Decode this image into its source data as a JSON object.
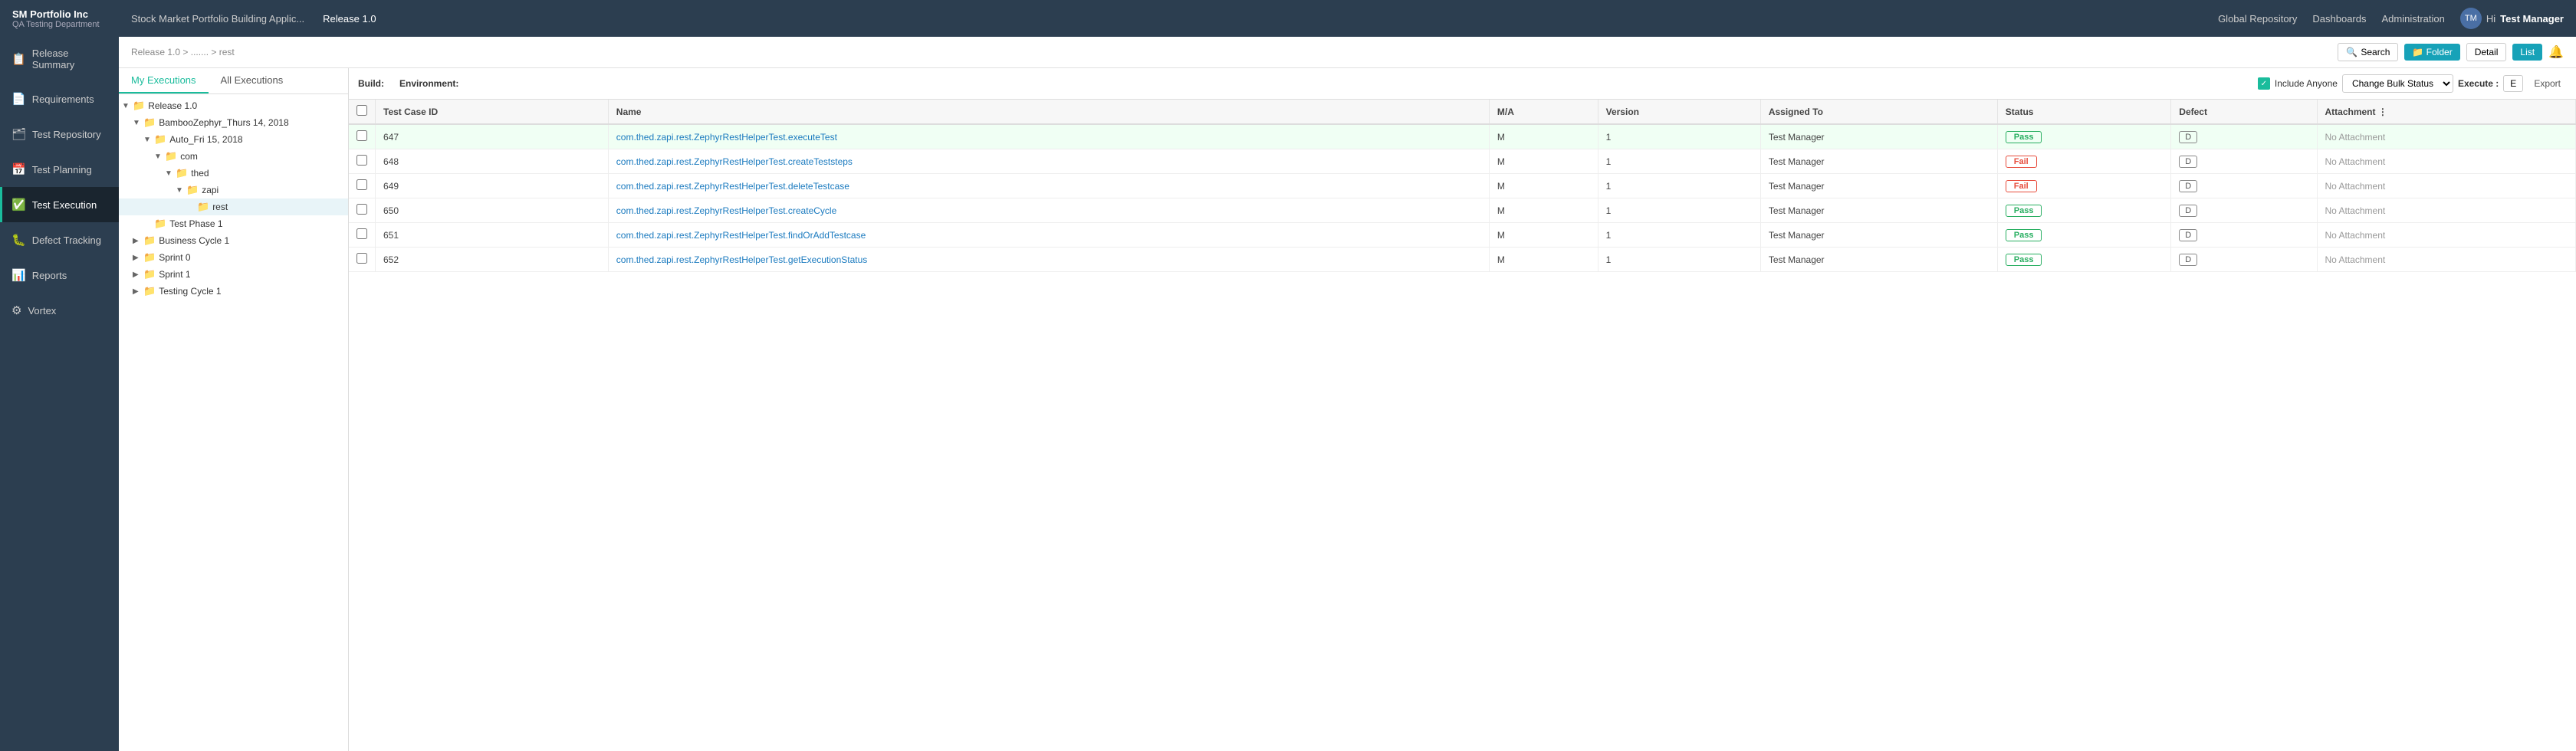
{
  "brand": {
    "name": "SM Portfolio Inc",
    "sub": "QA Testing Department"
  },
  "topnav": {
    "project": "Stock Market Portfolio Building Applic...",
    "release": "Release 1.0",
    "links": [
      "Global Repository",
      "Dashboards",
      "Administration"
    ],
    "user_hi": "Hi",
    "user_name": "Test Manager"
  },
  "sidebar": {
    "items": [
      {
        "label": "Release Summary",
        "icon": "📋",
        "active": false
      },
      {
        "label": "Requirements",
        "icon": "📄",
        "active": false
      },
      {
        "label": "Test Repository",
        "icon": "🗂",
        "active": false
      },
      {
        "label": "Test Planning",
        "icon": "📅",
        "active": false
      },
      {
        "label": "Test Execution",
        "icon": "✅",
        "active": true
      },
      {
        "label": "Defect Tracking",
        "icon": "🐛",
        "active": false
      },
      {
        "label": "Reports",
        "icon": "📊",
        "active": false
      },
      {
        "label": "Vortex",
        "icon": "⚙",
        "active": false
      }
    ]
  },
  "breadcrumb": {
    "parts": [
      "Release 1.0",
      ">",
      ".......",
      ">",
      "rest"
    ]
  },
  "toolbar_buttons": {
    "search": "🔍 Search",
    "folder": "📁 Folder",
    "detail": "Detail",
    "list": "List"
  },
  "tabs": {
    "my_executions": "My Executions",
    "all_executions": "All Executions"
  },
  "tree": {
    "items": [
      {
        "indent": 0,
        "toggle": "▼",
        "label": "Release 1.0",
        "icon": "folder"
      },
      {
        "indent": 1,
        "toggle": "▼",
        "label": "BambooZephyr_Thurs 14, 2018",
        "icon": "folder-dark"
      },
      {
        "indent": 2,
        "toggle": "▼",
        "label": "Auto_Fri 15, 2018",
        "icon": "folder-dark"
      },
      {
        "indent": 3,
        "toggle": "▼",
        "label": "com",
        "icon": "folder"
      },
      {
        "indent": 4,
        "toggle": "▼",
        "label": "thed",
        "icon": "folder"
      },
      {
        "indent": 5,
        "toggle": "▼",
        "label": "zapi",
        "icon": "folder"
      },
      {
        "indent": 6,
        "toggle": "",
        "label": "rest",
        "icon": "folder-light",
        "selected": true
      },
      {
        "indent": 2,
        "toggle": "",
        "label": "Test Phase 1",
        "icon": "folder-light"
      },
      {
        "indent": 1,
        "toggle": "▶",
        "label": "Business Cycle 1",
        "icon": "folder-light"
      },
      {
        "indent": 1,
        "toggle": "▶",
        "label": "Sprint 0",
        "icon": "folder-light"
      },
      {
        "indent": 1,
        "toggle": "▶",
        "label": "Sprint 1",
        "icon": "folder-light"
      },
      {
        "indent": 1,
        "toggle": "▶",
        "label": "Testing Cycle 1",
        "icon": "folder-light"
      }
    ]
  },
  "toolbar": {
    "build_label": "Build:",
    "environment_label": "Environment:",
    "include_anyone": "Include Anyone",
    "change_bulk_status": "Change Bulk Status",
    "execute_label": "Execute :",
    "execute_key": "E",
    "export_label": "Export"
  },
  "table": {
    "columns": [
      "",
      "Test Case ID",
      "Name",
      "M/A",
      "Version",
      "Assigned To",
      "Status",
      "Defect",
      "Attachment"
    ],
    "rows": [
      {
        "id": "647",
        "name": "com.thed.zapi.rest.ZephyrRestHelperTest.executeTest",
        "ma": "M",
        "version": "1",
        "assigned": "Test Manager",
        "status": "Pass",
        "defect": "D",
        "attachment": "No Attachment",
        "highlight": true
      },
      {
        "id": "648",
        "name": "com.thed.zapi.rest.ZephyrRestHelperTest.createTeststeps",
        "ma": "M",
        "version": "1",
        "assigned": "Test Manager",
        "status": "Fail",
        "defect": "D",
        "attachment": "No Attachment",
        "highlight": false
      },
      {
        "id": "649",
        "name": "com.thed.zapi.rest.ZephyrRestHelperTest.deleteTestcase",
        "ma": "M",
        "version": "1",
        "assigned": "Test Manager",
        "status": "Fail",
        "defect": "D",
        "attachment": "No Attachment",
        "highlight": false
      },
      {
        "id": "650",
        "name": "com.thed.zapi.rest.ZephyrRestHelperTest.createCycle",
        "ma": "M",
        "version": "1",
        "assigned": "Test Manager",
        "status": "Pass",
        "defect": "D",
        "attachment": "No Attachment",
        "highlight": false
      },
      {
        "id": "651",
        "name": "com.thed.zapi.rest.ZephyrRestHelperTest.findOrAddTestcase",
        "ma": "M",
        "version": "1",
        "assigned": "Test Manager",
        "status": "Pass",
        "defect": "D",
        "attachment": "No Attachment",
        "highlight": false
      },
      {
        "id": "652",
        "name": "com.thed.zapi.rest.ZephyrRestHelperTest.getExecutionStatus",
        "ma": "M",
        "version": "1",
        "assigned": "Test Manager",
        "status": "Pass",
        "defect": "D",
        "attachment": "No Attachment",
        "highlight": false
      }
    ]
  }
}
